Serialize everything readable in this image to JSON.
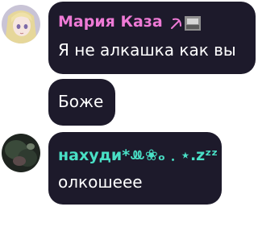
{
  "messages": [
    {
      "sender": "Мария Каза",
      "sender_color": "#ee7ad6",
      "sender_badge": "hammer-sickle-and-photo-icon",
      "text": "Я не алкашка как вы",
      "avatar": "anime-blonde-girl-avatar"
    },
    {
      "text": "Боже"
    },
    {
      "sender": "нахуди*ꔛ❀ₒ﹒⋆.zᶻᶻ",
      "sender_color": "#49e0c6",
      "text": "олкошеее",
      "avatar": "dark-photo-avatar"
    }
  ],
  "colors": {
    "bubble": "#1d1a2b",
    "background": "#ffffff"
  }
}
